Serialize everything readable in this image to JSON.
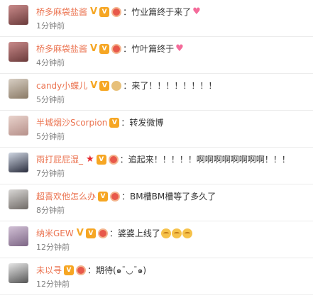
{
  "comments": [
    {
      "user": "桥多麻袋盐酱",
      "text": "竹业篇终于来了",
      "time": "1分钟前",
      "badges": [
        "v-badge",
        "member-badge",
        "club-badge"
      ],
      "emoji": [
        "heart"
      ],
      "avatar_colors": [
        "#c98a8a",
        "#6b3b3b"
      ]
    },
    {
      "user": "桥多麻袋盐酱",
      "text": "竹叶篇终于",
      "time": "4分钟前",
      "badges": [
        "v-badge",
        "member-badge",
        "club-badge"
      ],
      "emoji": [
        "heart"
      ],
      "avatar_colors": [
        "#c98a8a",
        "#6b3b3b"
      ]
    },
    {
      "user": "candy小蝶儿",
      "text": "来了！！！！！！！！",
      "time": "5分钟前",
      "badges": [
        "v-badge",
        "member-badge",
        "face-badge"
      ],
      "emoji": [],
      "avatar_colors": [
        "#d8cfc4",
        "#8a7a66"
      ]
    },
    {
      "user": "半城烟沙Scorpion",
      "text": "转发微博",
      "time": "5分钟前",
      "badges": [
        "member-badge"
      ],
      "emoji": [],
      "avatar_colors": [
        "#e9d3cc",
        "#b6908a"
      ]
    },
    {
      "user": "雨打屁屁湿_",
      "text": "追起来！！！！！啊啊啊啊啊啊啊啊！！！",
      "time": "7分钟前",
      "badges": [
        "star-badge",
        "member-badge",
        "club-badge"
      ],
      "emoji": [],
      "avatar_colors": [
        "#cfd6e2",
        "#2a2d3d"
      ]
    },
    {
      "user": "超喜欢他怎么办",
      "text": "BM槽BM槽等了多久了",
      "time": "8分钟前",
      "badges": [
        "member-badge",
        "club-badge"
      ],
      "emoji": [],
      "avatar_colors": [
        "#d9d7d5",
        "#6f6a66"
      ]
    },
    {
      "user": "纳米GEW",
      "text": "婆婆上线了",
      "time": "12分钟前",
      "badges": [
        "v-badge",
        "member-badge",
        "club-badge"
      ],
      "emoji": [
        "face",
        "face",
        "face"
      ],
      "avatar_colors": [
        "#d2c1d6",
        "#7d6685"
      ]
    },
    {
      "user": "未以寻",
      "text": "期待(๑¯◡¯๑)",
      "time": "12分钟前",
      "badges": [
        "member-badge",
        "club-badge"
      ],
      "emoji": [],
      "avatar_colors": [
        "#e6e6e6",
        "#555555"
      ]
    }
  ],
  "colors": {
    "username": "#eb7350",
    "text": "#333333",
    "time": "#808080",
    "divider": "#ececec"
  }
}
